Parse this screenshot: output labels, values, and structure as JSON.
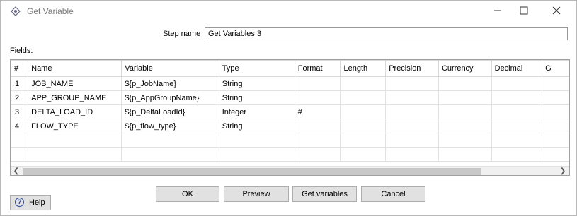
{
  "window": {
    "title": "Get Variable"
  },
  "step": {
    "label": "Step name",
    "value": "Get Variables 3"
  },
  "fields": {
    "label": "Fields:",
    "columns": [
      "#",
      "Name",
      "Variable",
      "Type",
      "Format",
      "Length",
      "Precision",
      "Currency",
      "Decimal",
      "G"
    ],
    "rows": [
      [
        "1",
        "JOB_NAME",
        "${p_JobName}",
        "String",
        "",
        "",
        "",
        "",
        "",
        ""
      ],
      [
        "2",
        "APP_GROUP_NAME",
        "${p_AppGroupName}",
        "String",
        "",
        "",
        "",
        "",
        "",
        ""
      ],
      [
        "3",
        "DELTA_LOAD_ID",
        "${p_DeltaLoadId}",
        "Integer",
        "#",
        "",
        "",
        "",
        "",
        ""
      ],
      [
        "4",
        "FLOW_TYPE",
        "${p_flow_type}",
        "String",
        "",
        "",
        "",
        "",
        "",
        ""
      ],
      [
        "",
        "",
        "",
        "",
        "",
        "",
        "",
        "",
        "",
        ""
      ],
      [
        "",
        "",
        "",
        "",
        "",
        "",
        "",
        "",
        "",
        ""
      ]
    ]
  },
  "buttons": {
    "ok": "OK",
    "preview": "Preview",
    "get_variables": "Get variables",
    "cancel": "Cancel",
    "help": "Help"
  },
  "icons": {
    "app": "variable-icon",
    "help": "help-icon"
  }
}
